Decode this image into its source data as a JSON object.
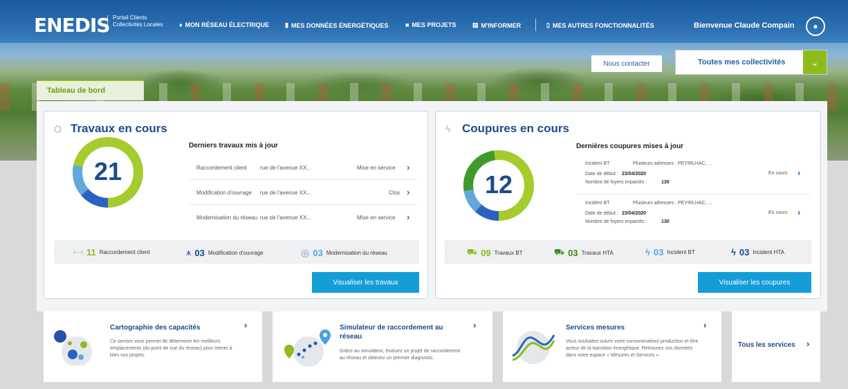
{
  "header": {
    "logo": "ENEDIS",
    "portal_line1": "Portail Clients",
    "portal_line2": "Collectivités Locales",
    "nav": [
      {
        "icon": "lightbulb-icon",
        "glyph": "♦",
        "label": "MON RÉSEAU ÉLECTRIQUE"
      },
      {
        "icon": "bar-chart-icon",
        "glyph": "▮",
        "label": "MES DONNÉES ÉNERGÉTIQUES"
      },
      {
        "icon": "folder-icon",
        "glyph": "■",
        "label": "MES PROJETS"
      },
      {
        "icon": "document-icon",
        "glyph": "▤",
        "label": "M'INFORMER"
      },
      {
        "icon": "book-icon",
        "glyph": "▯",
        "label": "MES AUTRES FONCTIONNALITÉS"
      }
    ],
    "welcome": "Bienvenue Claude Compain",
    "user_glyph": "●"
  },
  "actions": {
    "contact": "Nous contacter",
    "collectivites": "Toutes mes collectivités",
    "chevron": "⌄"
  },
  "tab": "Tableau de bord",
  "colors": {
    "primary": "#1c4b8c",
    "accent_green": "#8dbb1c",
    "button_blue": "#159dd8"
  },
  "travaux": {
    "title": "Travaux en cours",
    "icon_glyph": "⛭",
    "count": "21",
    "subtitle": "Derniers travaux mis à jour",
    "rows": [
      {
        "type": "Raccordement client",
        "address": "rue de l'avenue XX...",
        "status": "Mise en service"
      },
      {
        "type": "Modification d'ouvrage",
        "address": "rue de l'avenue XX...",
        "status": "Clos"
      },
      {
        "type": "Modernisation du réseau",
        "address": "rue de l'avenue XX...",
        "status": "Mise en service"
      }
    ],
    "stats": [
      {
        "icon": "connection-icon",
        "glyph": "⊢⊣",
        "count": "11",
        "label": "Raccordement client",
        "color": "#8dbb1c"
      },
      {
        "icon": "pylon-icon",
        "glyph": "⩚",
        "count": "03",
        "label": "Modification d'ouvrage",
        "color": "#1c4b8c"
      },
      {
        "icon": "refresh-icon",
        "glyph": "◎",
        "count": "03",
        "label": "Modernisation du réseau",
        "color": "#5aa6dd"
      }
    ],
    "button": "Visualiser les travaux"
  },
  "coupures": {
    "title": "Coupures en cours",
    "icon_glyph": "ϟ",
    "count": "12",
    "subtitle": "Dernières coupures mises à jour",
    "rows": [
      {
        "type": "Incident BT",
        "address": "Plusieurs adresses : PEYRILHAC, ...",
        "date_label": "Date de début :",
        "date": "23/04/2020",
        "foyers_label": "Nombre de foyers impactés :",
        "foyers": "130",
        "status": "En cours"
      },
      {
        "type": "Incident BT",
        "address": "Plusieurs adresses : PEYRILHAC, ...",
        "date_label": "Date de début :",
        "date": "23/04/2020",
        "foyers_label": "Nombre de foyers impactés :",
        "foyers": "130",
        "status": "En cours"
      }
    ],
    "stats": [
      {
        "icon": "work-truck-icon",
        "glyph": "⛟",
        "count": "09",
        "label": "Travaux BT",
        "color": "#8dbb1c"
      },
      {
        "icon": "work-truck-icon",
        "glyph": "⛟",
        "count": "03",
        "label": "Travaux HTA",
        "color": "#3a8c1a"
      },
      {
        "icon": "lightning-icon",
        "glyph": "ϟ",
        "count": "03",
        "label": "Incident BT",
        "color": "#5aa6dd"
      },
      {
        "icon": "lightning-icon",
        "glyph": "ϟ",
        "count": "03",
        "label": "Incident HTA",
        "color": "#1c4b8c"
      }
    ],
    "button": "Visualiser les coupures"
  },
  "services": [
    {
      "title": "Cartographie des capacités",
      "desc": "Ce service vous permet de déterminer les meilleurs emplacements (du point de vue du réseau) pour mener à bien vos projets.",
      "icon": "map-dots-icon"
    },
    {
      "title": "Simulateur de raccordement au réseau",
      "desc": "Grâce au simulateur, évaluez un projet de raccordement au réseau et obtenez un premier diagnostic.",
      "icon": "map-pin-icon"
    },
    {
      "title": "Services mesures",
      "desc": "Vous souhaitez suivre votre consommation/ production et être acteur de la transition énergétique. Retrouvez vos données dans votre espace « Mesures et Services ».",
      "icon": "curve-icon"
    }
  ],
  "all_services": "Tous les services",
  "chevron_right": "›"
}
